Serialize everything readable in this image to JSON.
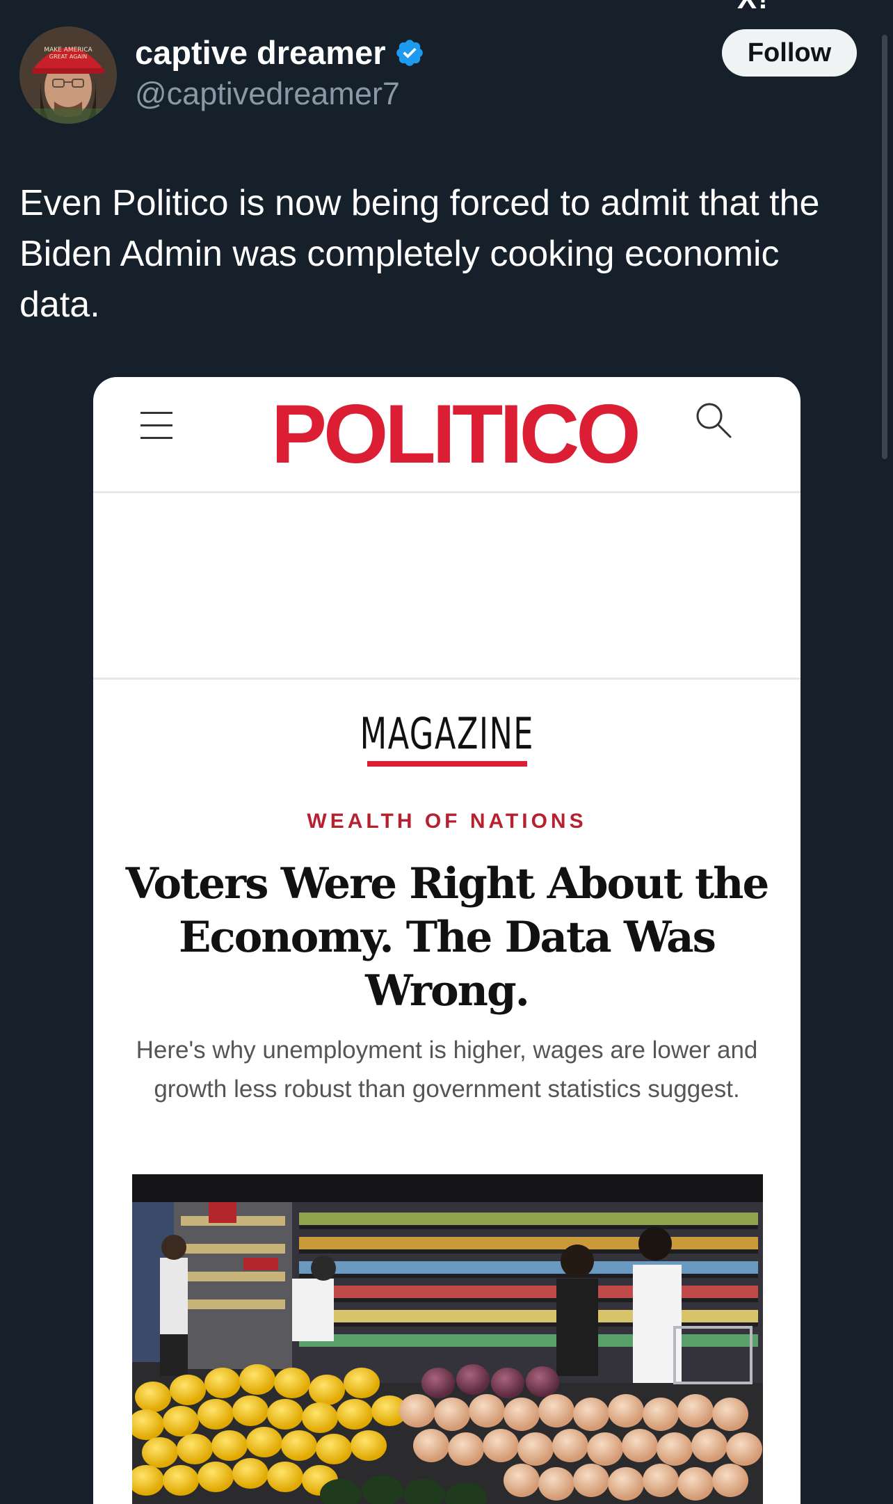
{
  "tweet": {
    "display_name": "captive dreamer",
    "verified": true,
    "handle": "@captivedreamer7",
    "follow_label": "Follow",
    "text": "Even Politico is now being forced to admit that the Biden Admin was completely cooking economic data."
  },
  "top_fragment": "X!",
  "article_card": {
    "logo": "POLITICO",
    "section": "MAGAZINE",
    "kicker": "WEALTH OF NATIONS",
    "headline": "Voters Were Right About the Economy. The Data Was Wrong.",
    "dek": "Here's why unemployment is higher, wages are lower and growth less robust than government statistics suggest.",
    "image_description_icon": "grocery-produce-photo"
  },
  "colors": {
    "background": "#15202b",
    "politico_red": "#dc1e35",
    "verified_blue": "#1d9bf0",
    "handle_gray": "#8b98a5",
    "follow_bg": "#eff3f4"
  }
}
